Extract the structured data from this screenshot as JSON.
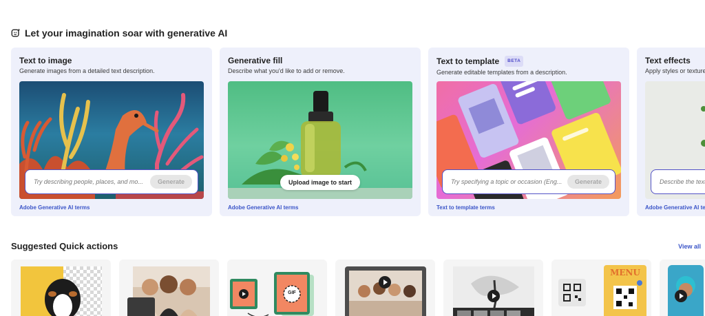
{
  "header": {
    "title": "Let your imagination soar with generative AI"
  },
  "cards": [
    {
      "title": "Text to image",
      "description": "Generate images from a detailed text description.",
      "prompt_placeholder": "Try describing people, places, and mo...",
      "button": "Generate",
      "terms": "Adobe Generative AI terms"
    },
    {
      "title": "Generative fill",
      "description": "Describe what you'd like to add or remove.",
      "button": "Upload image to start",
      "terms": "Adobe Generative AI terms"
    },
    {
      "title": "Text to template",
      "badge": "BETA",
      "description": "Generate editable templates from a description.",
      "prompt_placeholder": "Try specifying a topic or occasion (Eng...",
      "button": "Generate",
      "terms": "Text to template terms"
    },
    {
      "title": "Text effects",
      "description": "Apply styles or textures",
      "prompt_placeholder": "Describe the text",
      "terms": "Adobe Generative AI terms"
    }
  ],
  "quick_actions": {
    "title": "Suggested Quick actions",
    "view_all": "View all",
    "thumb_labels": {
      "gif": "GIF",
      "menu": "MENU"
    }
  },
  "colors": {
    "accent": "#5151c6",
    "link": "#3b55c8",
    "card_bg": "#eef0fb"
  }
}
